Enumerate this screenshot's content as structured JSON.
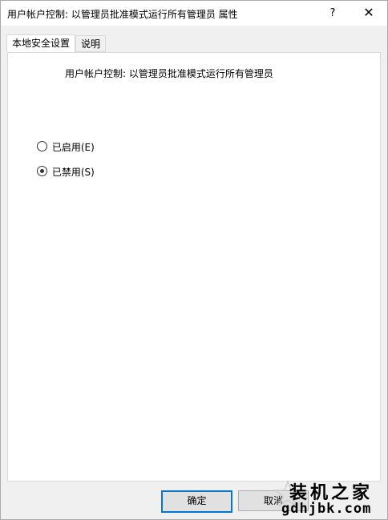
{
  "window": {
    "title": "用户帐户控制: 以管理员批准模式运行所有管理员 属性",
    "help_label": "?",
    "close_label": "✕"
  },
  "tabs": [
    {
      "label": "本地安全设置",
      "active": true
    },
    {
      "label": "说明",
      "active": false
    }
  ],
  "panel": {
    "icon": "server-icon",
    "heading": "用户帐户控制: 以管理员批准模式运行所有管理员",
    "options": [
      {
        "label": "已启用(E)",
        "checked": false
      },
      {
        "label": "已禁用(S)",
        "checked": true
      }
    ]
  },
  "buttons": {
    "ok_label": "确定",
    "cancel_label": "取消"
  },
  "watermark": {
    "site_name": "装机之家",
    "domain": "gdhjbk.com"
  }
}
